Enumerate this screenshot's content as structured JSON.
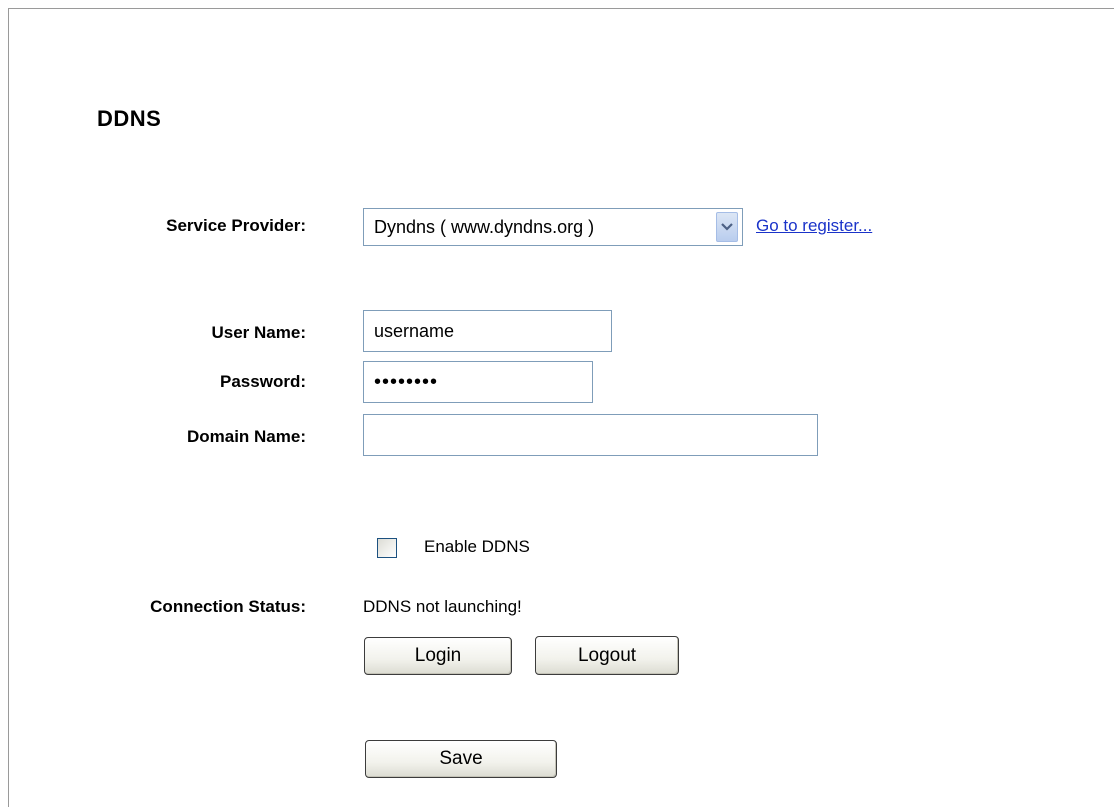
{
  "page": {
    "title": "DDNS"
  },
  "form": {
    "service_provider_label": "Service Provider:",
    "service_provider_value": "Dyndns ( www.dyndns.org )",
    "register_link": "Go to register...",
    "username_label": "User Name:",
    "username_value": "username",
    "password_label": "Password:",
    "password_value": "••••••••",
    "domain_label": "Domain Name:",
    "domain_value": "",
    "enable_label": "Enable DDNS",
    "enable_checked": false,
    "status_label": "Connection Status:",
    "status_value": "DDNS not launching!"
  },
  "buttons": {
    "login": "Login",
    "logout": "Logout",
    "save": "Save"
  },
  "icons": {
    "dropdown": "chevron-down-icon",
    "checkbox": "checkbox-icon"
  },
  "colors": {
    "link": "#1a33c9",
    "input_border": "#7f9db9"
  }
}
